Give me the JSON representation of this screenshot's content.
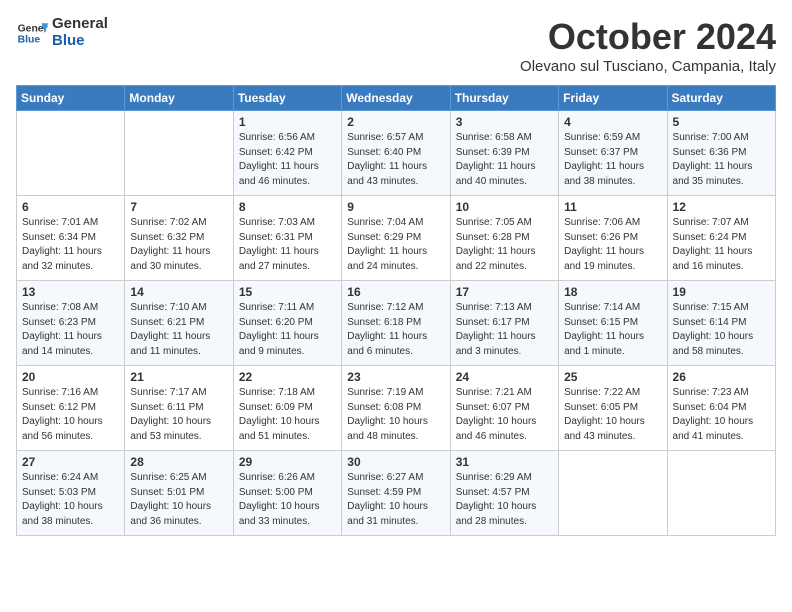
{
  "header": {
    "logo_line1": "General",
    "logo_line2": "Blue",
    "month_title": "October 2024",
    "subtitle": "Olevano sul Tusciano, Campania, Italy"
  },
  "days_of_week": [
    "Sunday",
    "Monday",
    "Tuesday",
    "Wednesday",
    "Thursday",
    "Friday",
    "Saturday"
  ],
  "weeks": [
    [
      {
        "day": "",
        "data": ""
      },
      {
        "day": "",
        "data": ""
      },
      {
        "day": "1",
        "sunrise": "6:56 AM",
        "sunset": "6:42 PM",
        "daylight": "11 hours and 46 minutes."
      },
      {
        "day": "2",
        "sunrise": "6:57 AM",
        "sunset": "6:40 PM",
        "daylight": "11 hours and 43 minutes."
      },
      {
        "day": "3",
        "sunrise": "6:58 AM",
        "sunset": "6:39 PM",
        "daylight": "11 hours and 40 minutes."
      },
      {
        "day": "4",
        "sunrise": "6:59 AM",
        "sunset": "6:37 PM",
        "daylight": "11 hours and 38 minutes."
      },
      {
        "day": "5",
        "sunrise": "7:00 AM",
        "sunset": "6:36 PM",
        "daylight": "11 hours and 35 minutes."
      }
    ],
    [
      {
        "day": "6",
        "sunrise": "7:01 AM",
        "sunset": "6:34 PM",
        "daylight": "11 hours and 32 minutes."
      },
      {
        "day": "7",
        "sunrise": "7:02 AM",
        "sunset": "6:32 PM",
        "daylight": "11 hours and 30 minutes."
      },
      {
        "day": "8",
        "sunrise": "7:03 AM",
        "sunset": "6:31 PM",
        "daylight": "11 hours and 27 minutes."
      },
      {
        "day": "9",
        "sunrise": "7:04 AM",
        "sunset": "6:29 PM",
        "daylight": "11 hours and 24 minutes."
      },
      {
        "day": "10",
        "sunrise": "7:05 AM",
        "sunset": "6:28 PM",
        "daylight": "11 hours and 22 minutes."
      },
      {
        "day": "11",
        "sunrise": "7:06 AM",
        "sunset": "6:26 PM",
        "daylight": "11 hours and 19 minutes."
      },
      {
        "day": "12",
        "sunrise": "7:07 AM",
        "sunset": "6:24 PM",
        "daylight": "11 hours and 16 minutes."
      }
    ],
    [
      {
        "day": "13",
        "sunrise": "7:08 AM",
        "sunset": "6:23 PM",
        "daylight": "11 hours and 14 minutes."
      },
      {
        "day": "14",
        "sunrise": "7:10 AM",
        "sunset": "6:21 PM",
        "daylight": "11 hours and 11 minutes."
      },
      {
        "day": "15",
        "sunrise": "7:11 AM",
        "sunset": "6:20 PM",
        "daylight": "11 hours and 9 minutes."
      },
      {
        "day": "16",
        "sunrise": "7:12 AM",
        "sunset": "6:18 PM",
        "daylight": "11 hours and 6 minutes."
      },
      {
        "day": "17",
        "sunrise": "7:13 AM",
        "sunset": "6:17 PM",
        "daylight": "11 hours and 3 minutes."
      },
      {
        "day": "18",
        "sunrise": "7:14 AM",
        "sunset": "6:15 PM",
        "daylight": "11 hours and 1 minute."
      },
      {
        "day": "19",
        "sunrise": "7:15 AM",
        "sunset": "6:14 PM",
        "daylight": "10 hours and 58 minutes."
      }
    ],
    [
      {
        "day": "20",
        "sunrise": "7:16 AM",
        "sunset": "6:12 PM",
        "daylight": "10 hours and 56 minutes."
      },
      {
        "day": "21",
        "sunrise": "7:17 AM",
        "sunset": "6:11 PM",
        "daylight": "10 hours and 53 minutes."
      },
      {
        "day": "22",
        "sunrise": "7:18 AM",
        "sunset": "6:09 PM",
        "daylight": "10 hours and 51 minutes."
      },
      {
        "day": "23",
        "sunrise": "7:19 AM",
        "sunset": "6:08 PM",
        "daylight": "10 hours and 48 minutes."
      },
      {
        "day": "24",
        "sunrise": "7:21 AM",
        "sunset": "6:07 PM",
        "daylight": "10 hours and 46 minutes."
      },
      {
        "day": "25",
        "sunrise": "7:22 AM",
        "sunset": "6:05 PM",
        "daylight": "10 hours and 43 minutes."
      },
      {
        "day": "26",
        "sunrise": "7:23 AM",
        "sunset": "6:04 PM",
        "daylight": "10 hours and 41 minutes."
      }
    ],
    [
      {
        "day": "27",
        "sunrise": "6:24 AM",
        "sunset": "5:03 PM",
        "daylight": "10 hours and 38 minutes."
      },
      {
        "day": "28",
        "sunrise": "6:25 AM",
        "sunset": "5:01 PM",
        "daylight": "10 hours and 36 minutes."
      },
      {
        "day": "29",
        "sunrise": "6:26 AM",
        "sunset": "5:00 PM",
        "daylight": "10 hours and 33 minutes."
      },
      {
        "day": "30",
        "sunrise": "6:27 AM",
        "sunset": "4:59 PM",
        "daylight": "10 hours and 31 minutes."
      },
      {
        "day": "31",
        "sunrise": "6:29 AM",
        "sunset": "4:57 PM",
        "daylight": "10 hours and 28 minutes."
      },
      {
        "day": "",
        "data": ""
      },
      {
        "day": "",
        "data": ""
      }
    ]
  ]
}
